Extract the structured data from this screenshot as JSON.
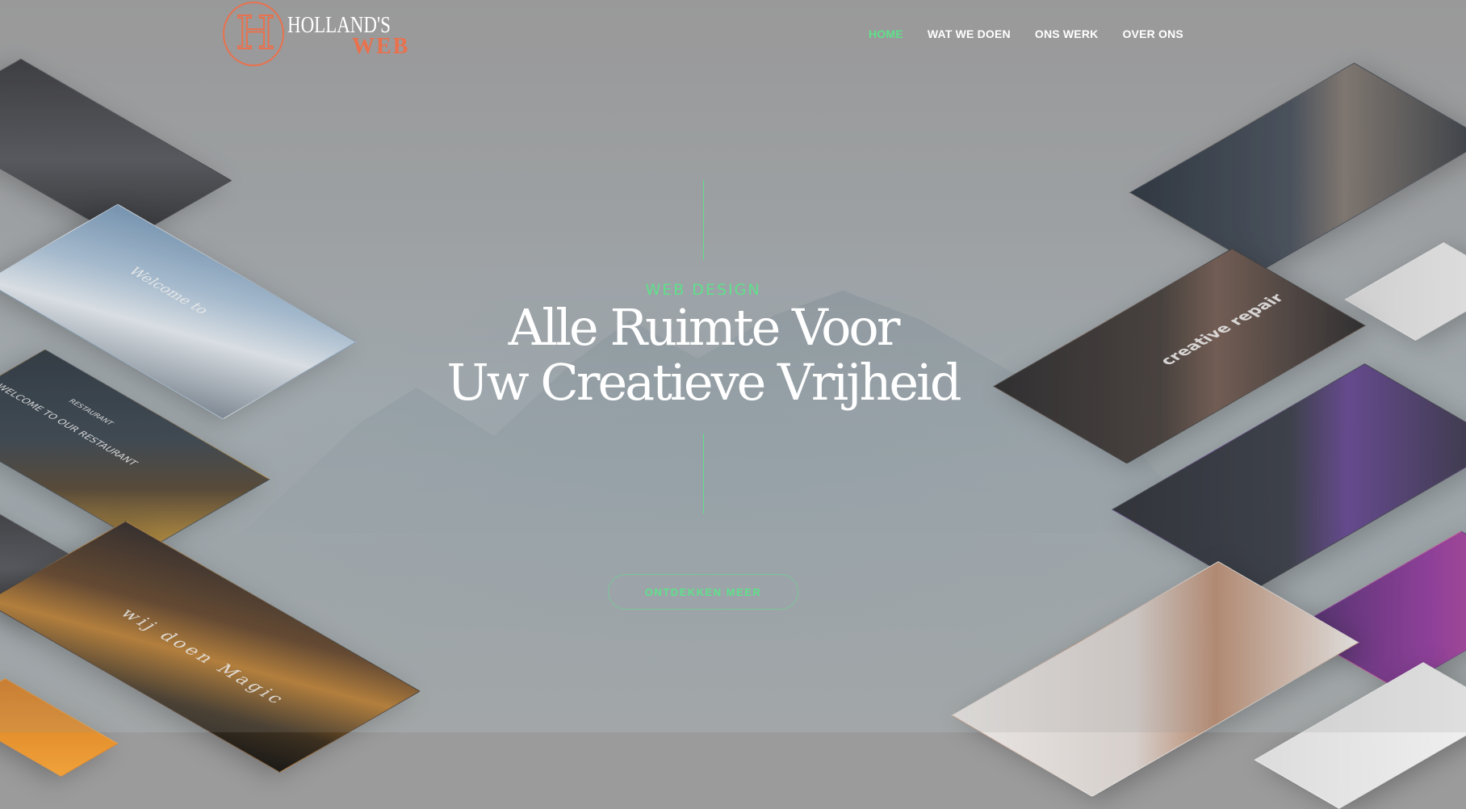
{
  "brand": {
    "logo_letter": "H",
    "name": "HOLLAND'S",
    "subname": "WEB"
  },
  "nav": {
    "items": [
      {
        "label": "HOME",
        "active": true
      },
      {
        "label": "WAT WE DOEN",
        "active": false
      },
      {
        "label": "ONS WERK",
        "active": false
      },
      {
        "label": "OVER ONS",
        "active": false
      }
    ]
  },
  "hero": {
    "eyebrow": "WEB DESIGN",
    "headline_line1": "Alle Ruimte Voor",
    "headline_line2": "Uw Creatieve Vrijheid",
    "cta_label": "ONTDEKKEN MEER"
  },
  "thumbnails": {
    "snow_text": "Welcome to",
    "restaurant_text": "WELCOME TO OUR RESTAURANT",
    "restaurant_badge": "RESTAURANT",
    "magic_text": "wij doen Magic",
    "creative_text": "creative repair"
  },
  "colors": {
    "accent": "#5fe08a",
    "brand": "#e9714d"
  }
}
